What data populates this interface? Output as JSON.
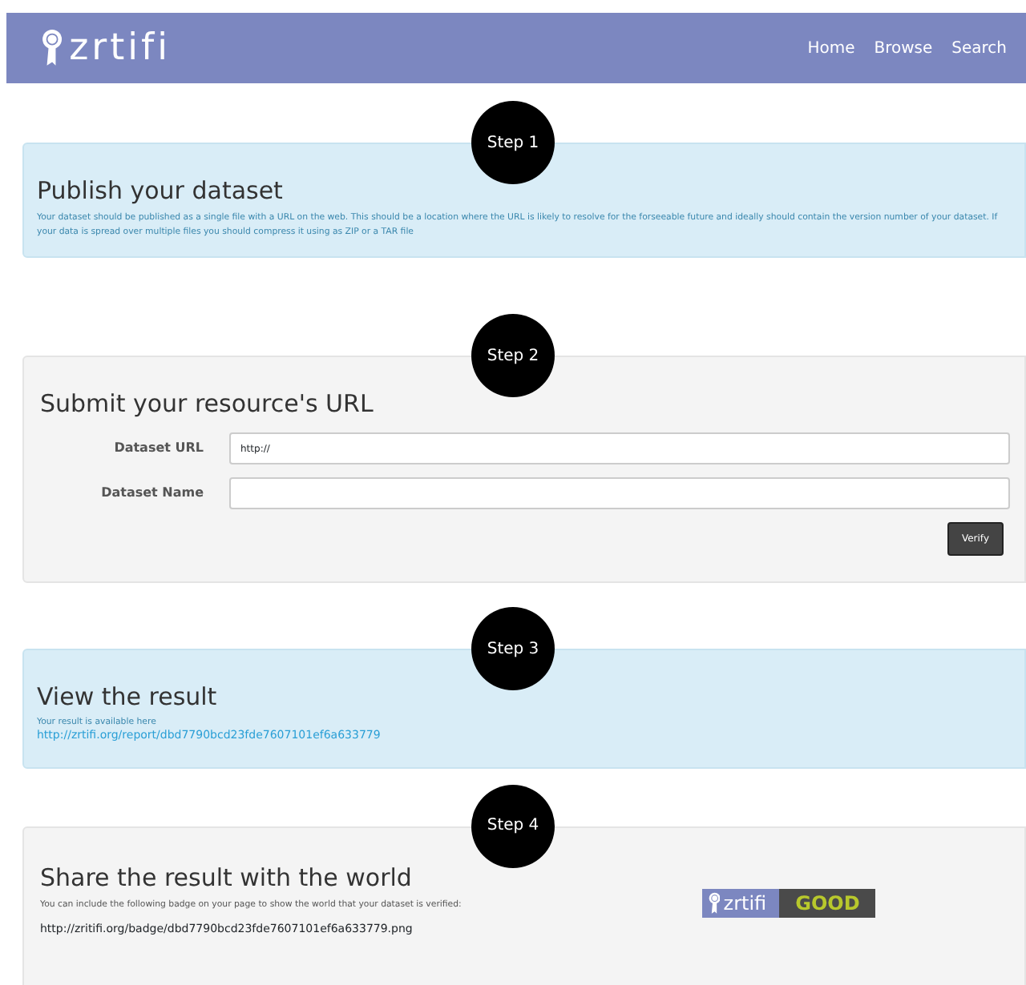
{
  "navbar": {
    "brand": "zrtifi",
    "links": [
      {
        "label": "Home"
      },
      {
        "label": "Browse"
      },
      {
        "label": "Search"
      }
    ]
  },
  "steps": [
    {
      "kind": "info",
      "step": "Step 1",
      "title": "Publish your dataset",
      "text": "Your dataset should be published as a single file with a URL on the web. This should be a location where the URL is likely to resolve for the forseeable future and ideally should contain the version number of your dataset. If your data is spread over multiple files you should compress it using as ZIP or a TAR file"
    },
    {
      "kind": "form",
      "step": "Step 2",
      "title": "Submit your resource's URL",
      "fields": [
        {
          "label": "Dataset URL",
          "value": "http://"
        },
        {
          "label": "Dataset Name"
        }
      ],
      "button": "Verify"
    },
    {
      "kind": "result",
      "step": "Step 3",
      "title": "View the result",
      "text": "Your result is available here",
      "link": "http://zrtifi.org/report/dbd7790bcd23fde7607101ef6a633779"
    },
    {
      "kind": "share",
      "step": "Step 4",
      "title": "Share the result with the world",
      "text": "You can include the following badge on your page to show the world that your dataset is verified:",
      "url": "http://zritifi.org/badge/dbd7790bcd23fde7607101ef6a633779.png",
      "badge": {
        "brand": "zrtifi",
        "rating": "GOOD"
      }
    }
  ]
}
